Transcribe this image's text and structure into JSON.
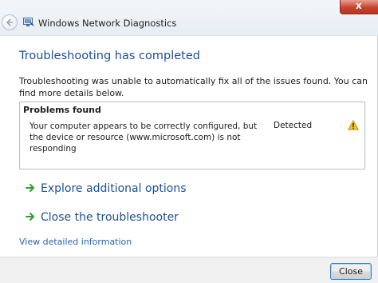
{
  "window": {
    "title": "Windows Network Diagnostics",
    "close_glyph": "x"
  },
  "main": {
    "heading": "Troubleshooting has completed",
    "message": "Troubleshooting was unable to automatically fix all of the issues found. You can find more details below."
  },
  "problems": {
    "header": "Problems found",
    "items": [
      {
        "description": "Your computer appears to be correctly configured, but the device or resource (www.microsoft.com) is not responding",
        "status": "Detected",
        "icon": "warning-icon"
      }
    ]
  },
  "options": [
    {
      "label": "Explore additional options",
      "icon": "green-arrow-icon"
    },
    {
      "label": "Close the troubleshooter",
      "icon": "green-arrow-icon"
    }
  ],
  "links": {
    "detailed": "View detailed information"
  },
  "footer": {
    "close_label": "Close"
  },
  "colors": {
    "heading": "#1f4e99",
    "link": "#2a64b4",
    "arrow": "#2e9e2e",
    "warning": "#f0c419"
  }
}
